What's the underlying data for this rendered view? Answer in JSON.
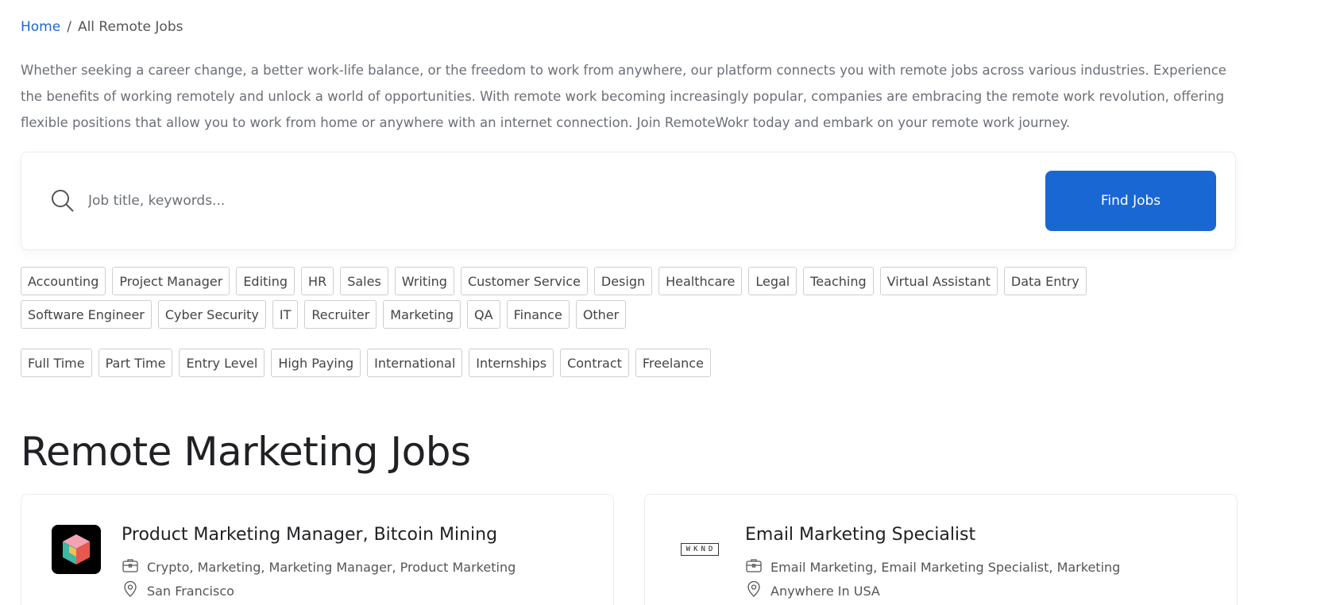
{
  "breadcrumb": {
    "home": "Home",
    "separator": "/",
    "current": "All Remote Jobs"
  },
  "intro": "Whether seeking a career change, a better work-life balance, or the freedom to work from anywhere, our platform connects you with remote jobs across various industries. Experience the benefits of working remotely and unlock a world of opportunities. With remote work becoming increasingly popular, companies are embracing the remote work revolution, offering flexible positions that allow you to work from home or anywhere with an internet connection. Join RemoteWokr today and embark on your remote work journey.",
  "search": {
    "placeholder": "Job title, keywords...",
    "button_label": "Find Jobs"
  },
  "categories": [
    "Accounting",
    "Project Manager",
    "Editing",
    "HR",
    "Sales",
    "Writing",
    "Customer Service",
    "Design",
    "Healthcare",
    "Legal",
    "Teaching",
    "Virtual Assistant",
    "Data Entry",
    "Software Engineer",
    "Cyber Security",
    "IT",
    "Recruiter",
    "Marketing",
    "QA",
    "Finance",
    "Other"
  ],
  "job_types": [
    "Full Time",
    "Part Time",
    "Entry Level",
    "High Paying",
    "International",
    "Internships",
    "Contract",
    "Freelance"
  ],
  "section_title": "Remote Marketing Jobs",
  "jobs": [
    {
      "title": "Product Marketing Manager, Bitcoin Mining",
      "tags": "Crypto, Marketing, Marketing Manager, Product Marketing",
      "location": "San Francisco",
      "logo": "cube-logo"
    },
    {
      "title": "Email Marketing Specialist",
      "tags": "Email Marketing, Email Marketing Specialist, Marketing",
      "location": "Anywhere In USA",
      "logo": "WKND"
    }
  ],
  "colors": {
    "accent": "#1967d2",
    "text_muted": "#6b6f76",
    "border": "#cfcfcf"
  }
}
